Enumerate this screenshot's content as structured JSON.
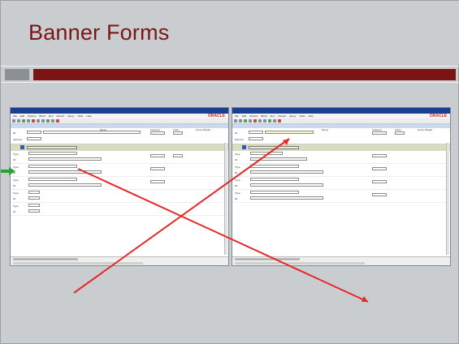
{
  "slide": {
    "title": "Banner Forms"
  },
  "colors": {
    "title": "#7a1616",
    "accent_bar": "#7c1414",
    "arrow_red": "#e52828",
    "arrow_green": "#27a33a",
    "oracle": "#d2302c"
  },
  "screenshot_left": {
    "brand": "ORACLE",
    "menu": [
      "File",
      "Edit",
      "Options",
      "Block",
      "Item",
      "Record",
      "Query",
      "Tools",
      "Help"
    ],
    "key_labels": [
      "ID:",
      "Sponsor:"
    ],
    "column_headers": [
      "Name",
      "Category",
      "Class",
      "Gross Weight"
    ],
    "row_labels": [
      "Type:",
      "ID:"
    ],
    "highlighted_section": "Relationship"
  },
  "screenshot_right": {
    "brand": "ORACLE",
    "menu": [
      "File",
      "Edit",
      "Options",
      "Block",
      "Item",
      "Record",
      "Query",
      "Tools",
      "Help"
    ],
    "key_labels": [
      "ID:",
      "Sponsor:"
    ],
    "column_headers": [
      "Name",
      "Category",
      "Class",
      "Gross Weight"
    ],
    "row_labels": [
      "Type:",
      "ID:"
    ],
    "highlighted_section": "Relationship"
  }
}
